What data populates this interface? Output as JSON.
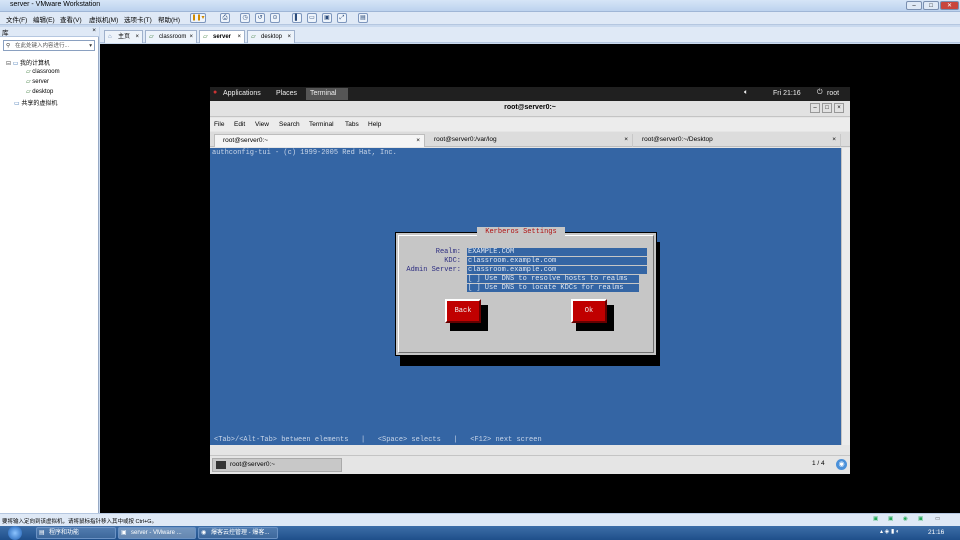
{
  "app": {
    "window_title": "server - VMware Workstation",
    "menu": [
      "文件(F)",
      "编辑(E)",
      "查看(V)",
      "虚拟机(M)",
      "选项卡(T)",
      "帮助(H)"
    ]
  },
  "library": {
    "header": "库",
    "search_placeholder": "在此处键入内容进行...",
    "tree": {
      "my_computer": "我的计算机",
      "vms": [
        "classroom",
        "server",
        "desktop"
      ],
      "shared": "共享的虚拟机"
    }
  },
  "vm_tabs": [
    {
      "label": "主页"
    },
    {
      "label": "classroom"
    },
    {
      "label": "server"
    },
    {
      "label": "desktop"
    }
  ],
  "gnome": {
    "applications": "Applications",
    "places": "Places",
    "terminal": "Terminal",
    "clock": "Fri 21:16",
    "user": "root",
    "window_title": "root@server0:~",
    "menu": [
      "File",
      "Edit",
      "View",
      "Search",
      "Terminal",
      "Tabs",
      "Help"
    ],
    "tabs": [
      "root@server0:~",
      "root@server0:/var/log",
      "root@server0:~/Desktop"
    ],
    "taskbar_item": "root@server0:~",
    "workspace": "1 / 4"
  },
  "terminal": {
    "header_line": "authconfig-tui - (c) 1999-2005 Red Hat, Inc.",
    "footer_line": "<Tab>/<Alt-Tab> between elements   |   <Space> selects   |   <F12> next screen",
    "dialog": {
      "title": "Kerberos Settings",
      "realm_label": "Realm:",
      "realm_value": "EXAMPLE.COM",
      "kdc_label": "KDC:",
      "kdc_value": "classroom.example.com",
      "admin_label": "Admin Server:",
      "admin_value": "classroom.example.com",
      "dns_realms": "[ ] Use DNS to resolve hosts to realms",
      "dns_kdcs": "[ ] Use DNS to locate KDCs for realms",
      "back": "Back",
      "ok": "Ok"
    }
  },
  "status_bar": "要将输入定向到该虚拟机，请将鼠标指针移入其中或按 Ctrl+G。",
  "taskbar": {
    "items": [
      "程序和功能",
      "server - VMware ...",
      "爆客云控管理 - 爆客..."
    ],
    "time": "21:16"
  }
}
